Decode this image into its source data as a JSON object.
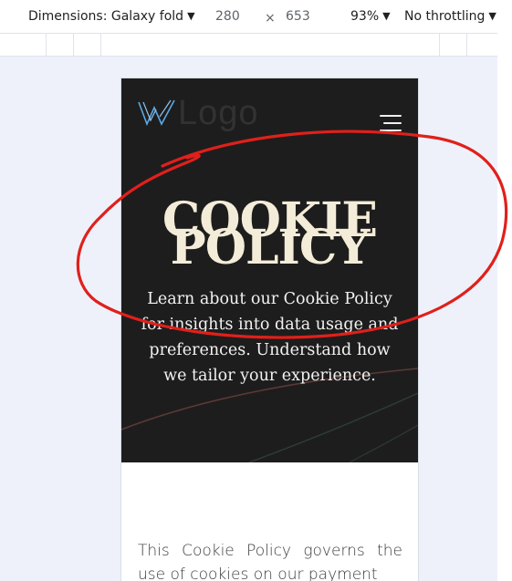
{
  "devtools": {
    "dimensions_label": "Dimensions: Galaxy fold",
    "width": "280",
    "times": "×",
    "height": "653",
    "zoom": "93%",
    "throttling": "No throttling",
    "caret": "▼"
  },
  "site": {
    "logo_text": "Logo",
    "hero_title_line1": "COOKIE",
    "hero_title_line2": "POLICY",
    "hero_description": "Learn about our Cookie Policy for insights into data usage and preferences. Understand how we tailor your experience.",
    "body_text": "This Cookie Policy governs the use of cookies on our payment"
  },
  "colors": {
    "hero_bg": "#1e1d1d",
    "hero_title": "#f3ecd8",
    "annotation": "#e0201b",
    "logo_accent": "#5aa9e6"
  },
  "icons": {
    "logo": "w-logo-icon",
    "menu": "hamburger-menu-icon",
    "dropdown": "caret-down-icon"
  }
}
